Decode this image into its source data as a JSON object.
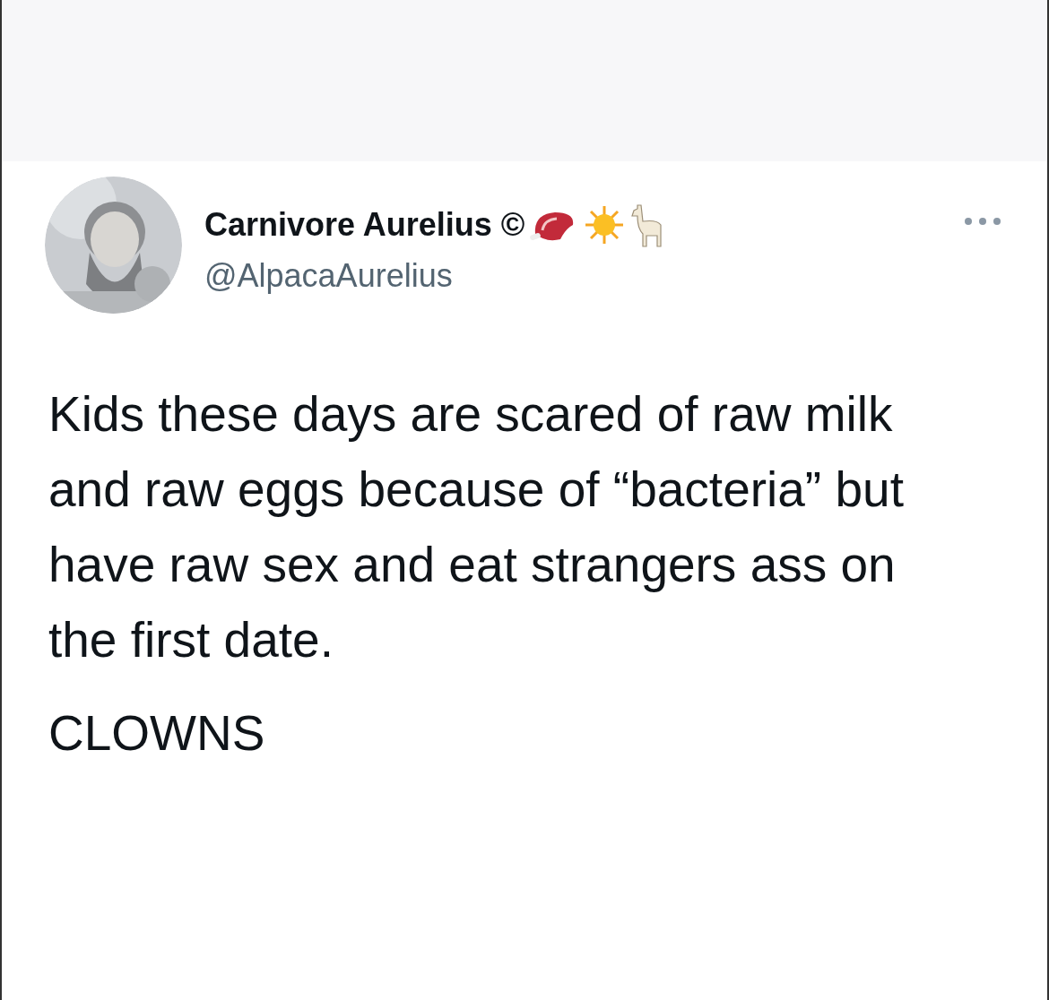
{
  "author": {
    "name": "Carnivore Aurelius ©",
    "handle": "@AlpacaAurelius"
  },
  "tweet": {
    "paragraphs": [
      "Kids these days are scared of raw milk and raw eggs because of “bacteria” but have raw sex and eat strangers ass on the first date.",
      "CLOWNS"
    ]
  }
}
